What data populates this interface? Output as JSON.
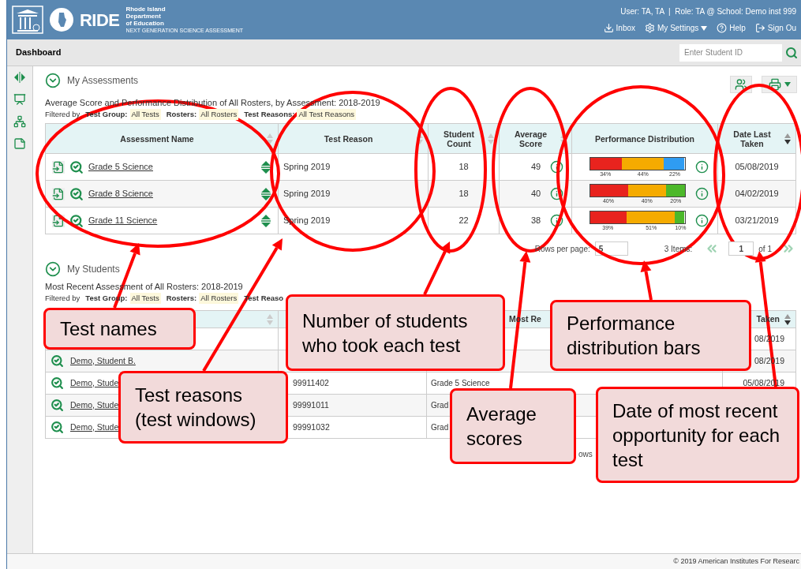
{
  "header": {
    "brand": "RIDE",
    "agency": [
      "Rhode Island",
      "Department",
      "of Education"
    ],
    "program": "NEXT GENERATION SCIENCE ASSESSMENT",
    "user_line": "User: TA, TA  |  Role: TA @ School: Demo inst 999",
    "links": [
      {
        "label": "Inbox",
        "kind": "download",
        "menu": false
      },
      {
        "label": "My Settings",
        "kind": "gear",
        "menu": true
      },
      {
        "label": "Help",
        "kind": "help",
        "menu": false
      },
      {
        "label": "Sign Ou",
        "kind": "signout",
        "menu": false
      }
    ]
  },
  "toolbar": {
    "title": "Dashboard",
    "search": {
      "placeholder": "Enter Student ID"
    }
  },
  "sidebar": {
    "items": [
      {
        "kind": "split"
      },
      {
        "kind": "teacher"
      },
      {
        "kind": "hierarchy"
      },
      {
        "kind": "note"
      }
    ]
  },
  "assessments": {
    "title": "My Assessments",
    "expanded": true,
    "subtitle": "Average Score and Performance Distribution of All Rosters, by Assessment: 2018-2019",
    "filter_prefix": "Filtered by",
    "filters": [
      {
        "label": "Test Group:",
        "value": "All Tests"
      },
      {
        "label": "Rosters:",
        "value": "All Rosters"
      },
      {
        "label": "Test Reasons:",
        "value": "All Test Reasons"
      }
    ],
    "columns": [
      {
        "label": "Assessment Name",
        "sortable": true,
        "sorted": false
      },
      {
        "label": "Test Reason",
        "sortable": true,
        "sorted": false
      },
      {
        "label": "Student Count",
        "sortable": true,
        "sorted": false
      },
      {
        "label": "Average Score",
        "sortable": true,
        "sorted": false
      },
      {
        "label": "Performance Distribution",
        "sortable": false
      },
      {
        "label": "Date Last Taken",
        "sortable": true,
        "sorted": true
      }
    ],
    "rows": [
      {
        "name": "Grade 5 Science",
        "reason": "Spring 2019",
        "count": "18",
        "average": "49",
        "date": "05/08/2019",
        "distribution": [
          {
            "label": "34%",
            "color": "#e8231e"
          },
          {
            "label": "44%",
            "color": "#f5ab00"
          },
          {
            "label": "22%",
            "color": "#2f9cf2"
          }
        ]
      },
      {
        "name": "Grade 8 Science",
        "reason": "Spring 2019",
        "count": "18",
        "average": "40",
        "date": "04/02/2019",
        "distribution": [
          {
            "label": "40%",
            "color": "#e8231e"
          },
          {
            "label": "40%",
            "color": "#f5ab00"
          },
          {
            "label": "20%",
            "color": "#4cb82a"
          }
        ]
      },
      {
        "name": "Grade 11 Science",
        "reason": "Spring 2019",
        "count": "22",
        "average": "38",
        "date": "03/21/2019",
        "distribution": [
          {
            "label": "39%",
            "color": "#e8231e"
          },
          {
            "label": "51%",
            "color": "#f5ab00"
          },
          {
            "label": "10%",
            "color": "#4cb82a"
          }
        ]
      }
    ],
    "pagination": {
      "rows_label": "Rows per page:",
      "rows_value": "5",
      "items": "3 Items:",
      "page": "1",
      "of": "of 1"
    }
  },
  "students": {
    "title": "My Students",
    "expanded": true,
    "subtitle": "Most Recent Assessment of All Rosters: 2018-2019",
    "filter_prefix": "Filtered by",
    "filters": [
      {
        "label": "Test Group:",
        "value": "All Tests"
      },
      {
        "label": "Rosters:",
        "value": "All Rosters"
      },
      {
        "label": "Test Reaso"
      }
    ],
    "columns": [
      {
        "sortable": true,
        "sorted": false
      },
      {},
      {
        "label": "Most Re"
      },
      {
        "label": "Taken",
        "sortable": true,
        "sorted": true
      }
    ],
    "rows": [
      {
        "date": "08/2019"
      },
      {
        "name": "Demo, Student B.",
        "date": "08/2019"
      },
      {
        "name": "Demo, Stude",
        "id": "99911402",
        "test": "Grade 5 Science",
        "date": "05/08/2019"
      },
      {
        "name": "Demo, Stude",
        "id": "99991011",
        "test": "Grad"
      },
      {
        "name": "Demo, Stude",
        "id": "99991032",
        "test": "Grad"
      }
    ],
    "pagination_fragment": "ows"
  },
  "callouts": [
    {
      "text": "Test names"
    },
    {
      "text": "Test reasons (test windows)"
    },
    {
      "text": "Number of students who took each test"
    },
    {
      "text": "Performance distribution bars"
    },
    {
      "text": "Average scores"
    },
    {
      "text": "Date of most recent opportunity for each test"
    }
  ],
  "footer": "© 2019 American Institutes For Researc"
}
